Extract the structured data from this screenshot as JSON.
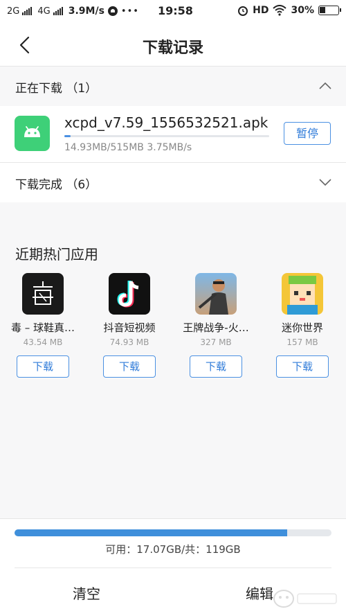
{
  "status_bar": {
    "net1": "2G",
    "net2": "4G",
    "speed": "3.9M/s",
    "dots": "•••",
    "time": "19:58",
    "hd": "HD",
    "battery": "30%"
  },
  "header": {
    "title": "下载记录"
  },
  "downloading": {
    "label": "正在下载 （1）",
    "item": {
      "file_name": "xcpd_v7.59_1556532521.apk",
      "progress_text": "14.93MB/515MB  3.75MB/s",
      "progress_fraction": 0.029,
      "pause_label": "暂停"
    }
  },
  "completed": {
    "label": "下载完成 （6）"
  },
  "hot_apps": {
    "title": "近期热门应用",
    "download_label": "下载",
    "apps": [
      {
        "name": "毒 – 球鞋真…",
        "size": "43.54 MB",
        "icon": "du-app-icon"
      },
      {
        "name": "抖音短视频",
        "size": "74.93 MB",
        "icon": "tiktok-app-icon"
      },
      {
        "name": "王牌战争-火…",
        "size": "327 MB",
        "icon": "ace-war-app-icon"
      },
      {
        "name": "迷你世界",
        "size": "157 MB",
        "icon": "mini-world-app-icon"
      }
    ]
  },
  "storage": {
    "text": "可用：17.07GB/共：119GB",
    "used_fraction": 0.86
  },
  "bottom_bar": {
    "clear_label": "清空",
    "edit_label": "编辑"
  },
  "colors": {
    "accent": "#4a90e2",
    "android_green": "#3ed078"
  }
}
